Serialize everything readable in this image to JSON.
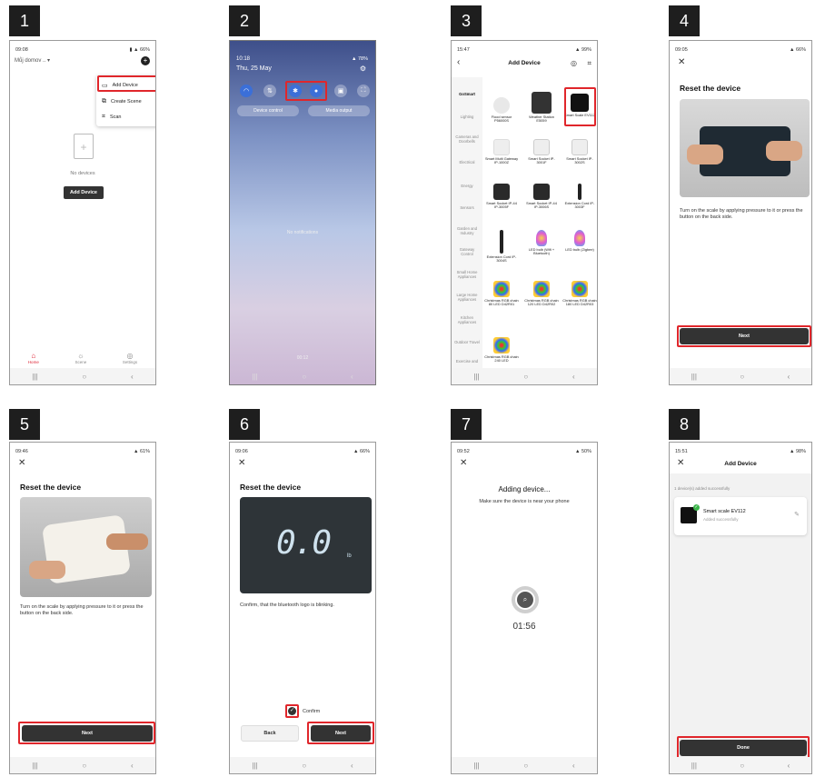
{
  "step_numbers": [
    "1",
    "2",
    "3",
    "4",
    "5",
    "6",
    "7",
    "8"
  ],
  "nav_glyphs": {
    "recent": "|||",
    "home": "○",
    "back": "‹"
  },
  "s1": {
    "time": "09:08",
    "battery": "66%",
    "home_name": "Můj domov",
    "home_name_suffix": "..  ▾",
    "menu": {
      "add_device": "Add Device",
      "create_scene": "Create Scene",
      "scan": "Scan"
    },
    "empty_text": "No devices",
    "add_button": "Add Device",
    "tabs": {
      "home": "Home",
      "scene": "Scene",
      "settings": "Settings"
    }
  },
  "s2": {
    "time": "10:18",
    "date": "Thu, 25 May",
    "battery": "78%",
    "device_control": "Device control",
    "media_output": "Media output",
    "notifications": "No notifications",
    "clock": "00:12"
  },
  "s3": {
    "time": "15:47",
    "battery": "99%",
    "title": "Add Device",
    "categories": [
      "GoSmart",
      "Lighting",
      "Cameras and Doorbells",
      "Electrical",
      "Energy",
      "Sensors",
      "Garden and Industry",
      "Gateway Control",
      "Small Home Appliances",
      "Large Home Appliances",
      "Kitchen Appliances",
      "Outdoor Travel",
      "Exercise and"
    ],
    "devices": [
      "Flood sensor P56000S",
      "Weather Station E5059",
      "Smart Scale EV112",
      "Smart Multi Gateway IP-1000Z",
      "Smart Socket IP-3001F",
      "Smart Socket IP-3002S",
      "Smart Socket IP-44 IP-3005F",
      "Smart Socket IP-44 IP-3006S",
      "Extension Cord IP-3003F",
      "Extension Cord IP-3004S",
      "LED bulb (Wifi + Bluetooth)",
      "LED bulb (Zigbee)",
      "Christmas RGB chain 80 LED D42R01",
      "Christmas RGB chain 120 LED D42R02",
      "Christmas RGB chain 180 LED D42R03",
      "Christmas RGB chain 240 LED"
    ]
  },
  "s4": {
    "time": "09:05",
    "battery": "66%",
    "title": "Reset the device",
    "instruction": "Turn on the scale by applying pressure to it or press the button on the back side.",
    "next": "Next"
  },
  "s5": {
    "time": "09:46",
    "battery": "61%",
    "title": "Reset the device",
    "instruction": "Turn on the scale by applying pressure to it or press the button on the back side.",
    "next": "Next"
  },
  "s6": {
    "time": "09:06",
    "battery": "66%",
    "title": "Reset the device",
    "lcd_value": "0.0",
    "lcd_unit": "lb",
    "instruction": "Confirm, that the bluetooth logo is blinking.",
    "confirm": "Confirm",
    "back": "Back",
    "next": "Next"
  },
  "s7": {
    "time": "09:52",
    "battery": "50%",
    "title": "Adding device...",
    "subtitle": "Make sure the device is near your phone",
    "countdown": "01:56"
  },
  "s8": {
    "time": "15:51",
    "battery": "98%",
    "title": "Add Device",
    "success_count": "1 device(s) added successfully",
    "device_name": "Smart scale EV112",
    "device_status": "Added successfully",
    "done": "Done"
  },
  "colors": {
    "highlight": "#e0262b",
    "dark_button": "#333333",
    "bluetooth_on": "#3b6fd8",
    "status_green": "#3bb54a"
  }
}
